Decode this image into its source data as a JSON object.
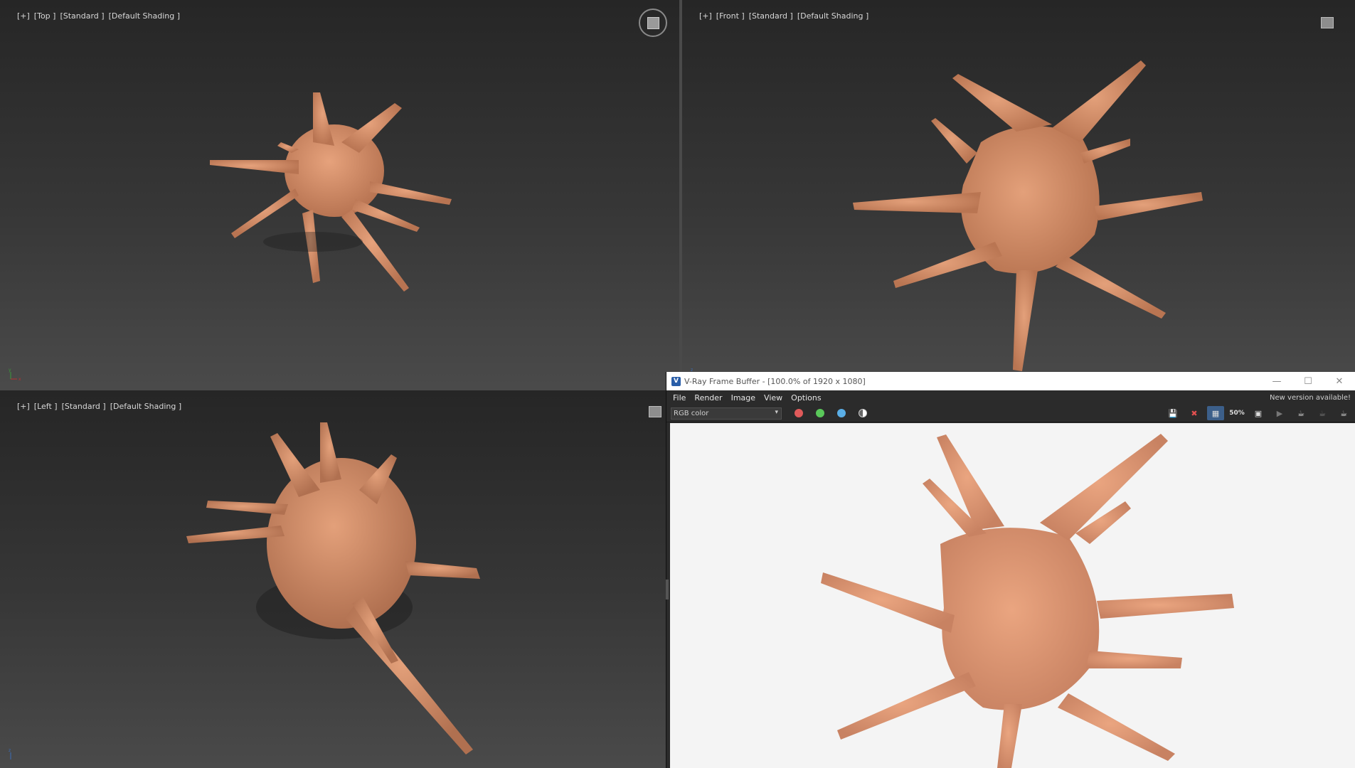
{
  "viewports": {
    "top": {
      "plus": "[+]",
      "view": "[Top ]",
      "mode": "[Standard ]",
      "shading": "[Default Shading ]"
    },
    "front": {
      "plus": "[+]",
      "view": "[Front ]",
      "mode": "[Standard ]",
      "shading": "[Default Shading ]"
    },
    "left": {
      "plus": "[+]",
      "view": "[Left ]",
      "mode": "[Standard ]",
      "shading": "[Default Shading ]"
    }
  },
  "vfb": {
    "title": "V-Ray Frame Buffer - [100.0% of 1920 x 1080]",
    "menu": [
      "File",
      "Render",
      "Image",
      "View",
      "Options"
    ],
    "notice": "New version available!",
    "channel": "RGB color",
    "tools": [
      "save-icon",
      "clear-icon",
      "region-select-icon",
      "zoom-50-icon",
      "region-render-icon",
      "track-mouse-icon",
      "render-interactive-icon",
      "render-last-icon",
      "render-teapot-icon"
    ],
    "zoom_label": "50%"
  },
  "colors": {
    "skin": "#d9966f",
    "skin_shadow": "#a86a4b",
    "viewport_bg": "#373737",
    "vfb_bg": "#f4f4f4"
  }
}
